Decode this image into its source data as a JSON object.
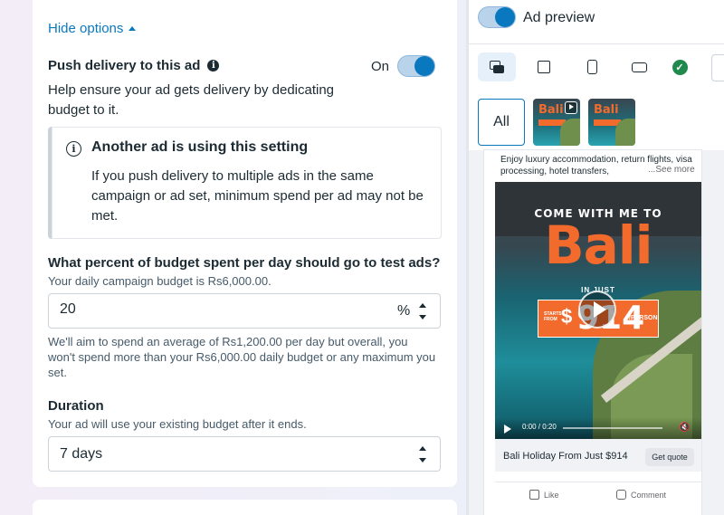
{
  "options": {
    "hide_options": "Hide options"
  },
  "push_delivery": {
    "title": "Push delivery to this ad",
    "description": "Help ensure your ad gets delivery by dedicating budget to it.",
    "toggle_label": "On",
    "enabled": true
  },
  "notice": {
    "title": "Another ad is using this setting",
    "body": "If you push delivery to multiple ads in the same campaign or ad set, minimum spend per ad may not be met."
  },
  "budget_question": {
    "title": "What percent of budget spent per day should go to test ads?",
    "subtitle": "Your daily campaign budget is Rs6,000.00.",
    "value": "20",
    "unit": "%",
    "help": "We'll aim to spend an average of Rs1,200.00 per day but overall, you won't spend more than your Rs6,000.00 daily budget or any maximum you set."
  },
  "duration": {
    "title": "Duration",
    "subtitle": "Your ad will use your existing budget after it ends.",
    "value": "7 days"
  },
  "preview": {
    "label": "Ad preview",
    "enabled": true,
    "thumbs": {
      "all_label": "All",
      "thumb_text": "Bali"
    },
    "post": {
      "text": "Enjoy luxury accommodation, return flights, visa processing, hotel transfers,",
      "see_more": "...See more",
      "video": {
        "line1": "COME WITH ME TO",
        "headline": "Bali",
        "in_just": "IN JUST",
        "starts_from": "STARTS FROM",
        "dollar": "$",
        "price": "914",
        "per": "/PERSON",
        "time": "0:00 / 0:20"
      },
      "cta_title": "Bali Holiday From Just $914",
      "cta_button": "Get quote",
      "like": "Like",
      "comment": "Comment"
    }
  },
  "colors": {
    "accent": "#0a78be",
    "brand_orange": "#f26a2c",
    "check_green": "#1f8a4c"
  }
}
